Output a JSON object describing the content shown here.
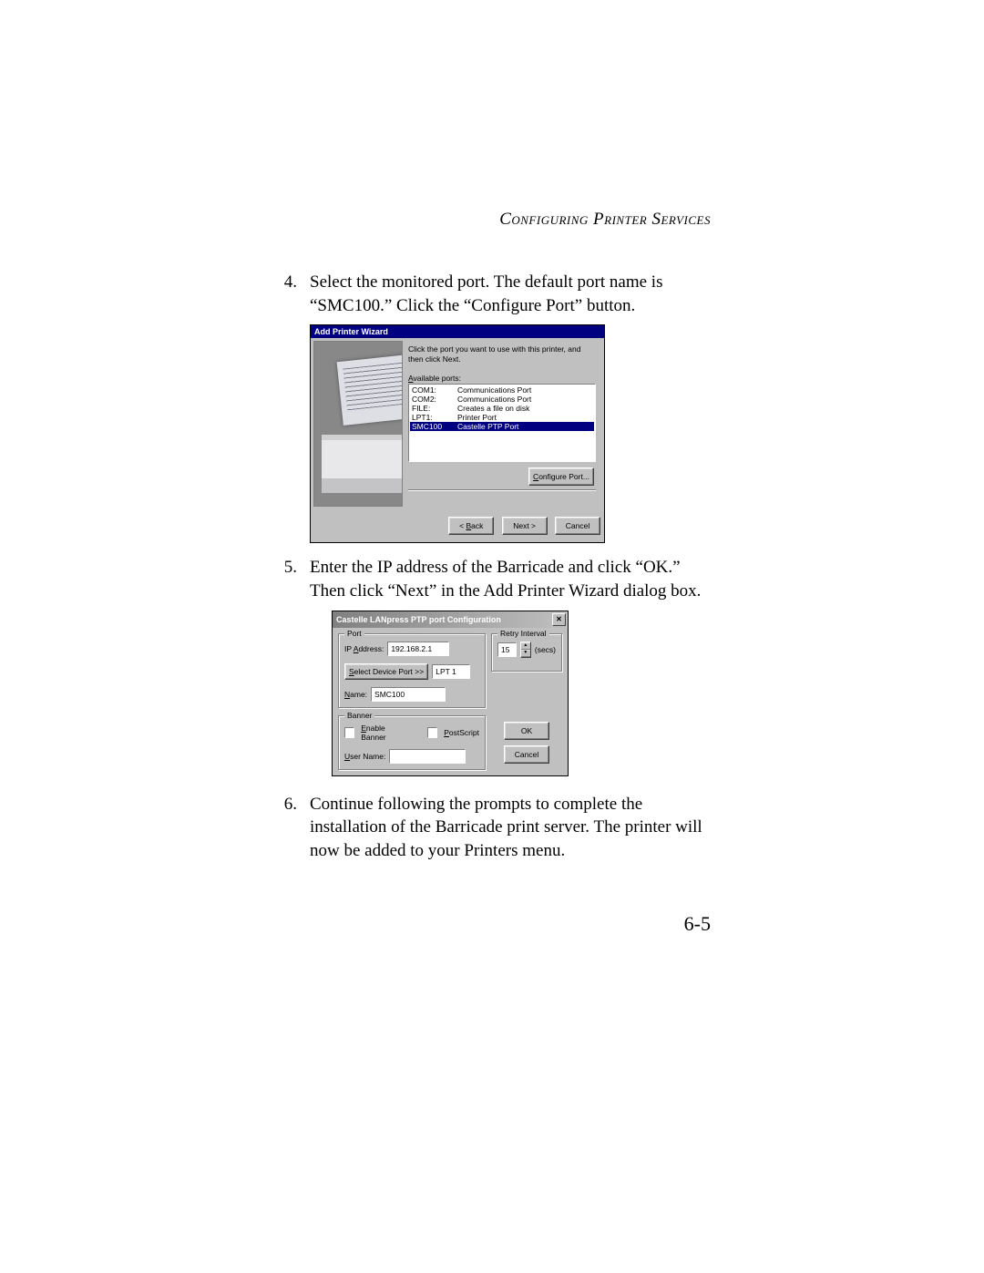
{
  "running_head": "Configuring Printer Services",
  "page_number": "6-5",
  "steps": [
    {
      "n": "4.",
      "text": "Select the monitored port. The default port name is “SMC100.” Click the “Configure Port” button."
    },
    {
      "n": "5.",
      "text": "Enter the IP address of the Barricade and click “OK.” Then click “Next” in the Add Printer Wizard dialog box."
    },
    {
      "n": "6.",
      "text": "Continue following the prompts to complete the installation of the Barricade print server. The printer will now be added to your Printers menu."
    }
  ],
  "wizard": {
    "title": "Add Printer Wizard",
    "prompt": "Click the port you want to use with this printer, and then click Next.",
    "list_label": "Available ports:",
    "list_label_ul": "A",
    "ports": [
      {
        "name": "COM1:",
        "desc": "Communications Port",
        "sel": false
      },
      {
        "name": "COM2:",
        "desc": "Communications Port",
        "sel": false
      },
      {
        "name": "FILE:",
        "desc": "Creates a file on disk",
        "sel": false
      },
      {
        "name": "LPT1:",
        "desc": "Printer Port",
        "sel": false
      },
      {
        "name": "SMC100",
        "desc": "Castelle  PTP  Port",
        "sel": true
      }
    ],
    "configure_btn": "Configure Port...",
    "configure_ul": "C",
    "back_btn": "< Back",
    "back_ul": "B",
    "next_btn": "Next >",
    "cancel_btn": "Cancel"
  },
  "dialog": {
    "title": "Castelle LANpress PTP port  Configuration",
    "port_group": "Port",
    "retry_group": "Retry Interval",
    "ip_label": "IP Address:",
    "ip_ul": "A",
    "ip_value": "192.168.2.1",
    "select_btn": "Select Device Port >>",
    "select_ul": "S",
    "device_port_value": "LPT 1",
    "name_label": "Name:",
    "name_ul": "N",
    "name_value": "SMC100",
    "retry_value": "15",
    "retry_unit": "(secs)",
    "banner_group": "Banner",
    "enable_banner": "Enable Banner",
    "enable_ul": "E",
    "postscript": "PostScript",
    "postscript_ul": "P",
    "user_label": "User Name:",
    "user_ul": "U",
    "user_value": "",
    "ok_btn": "OK",
    "cancel_btn": "Cancel"
  }
}
